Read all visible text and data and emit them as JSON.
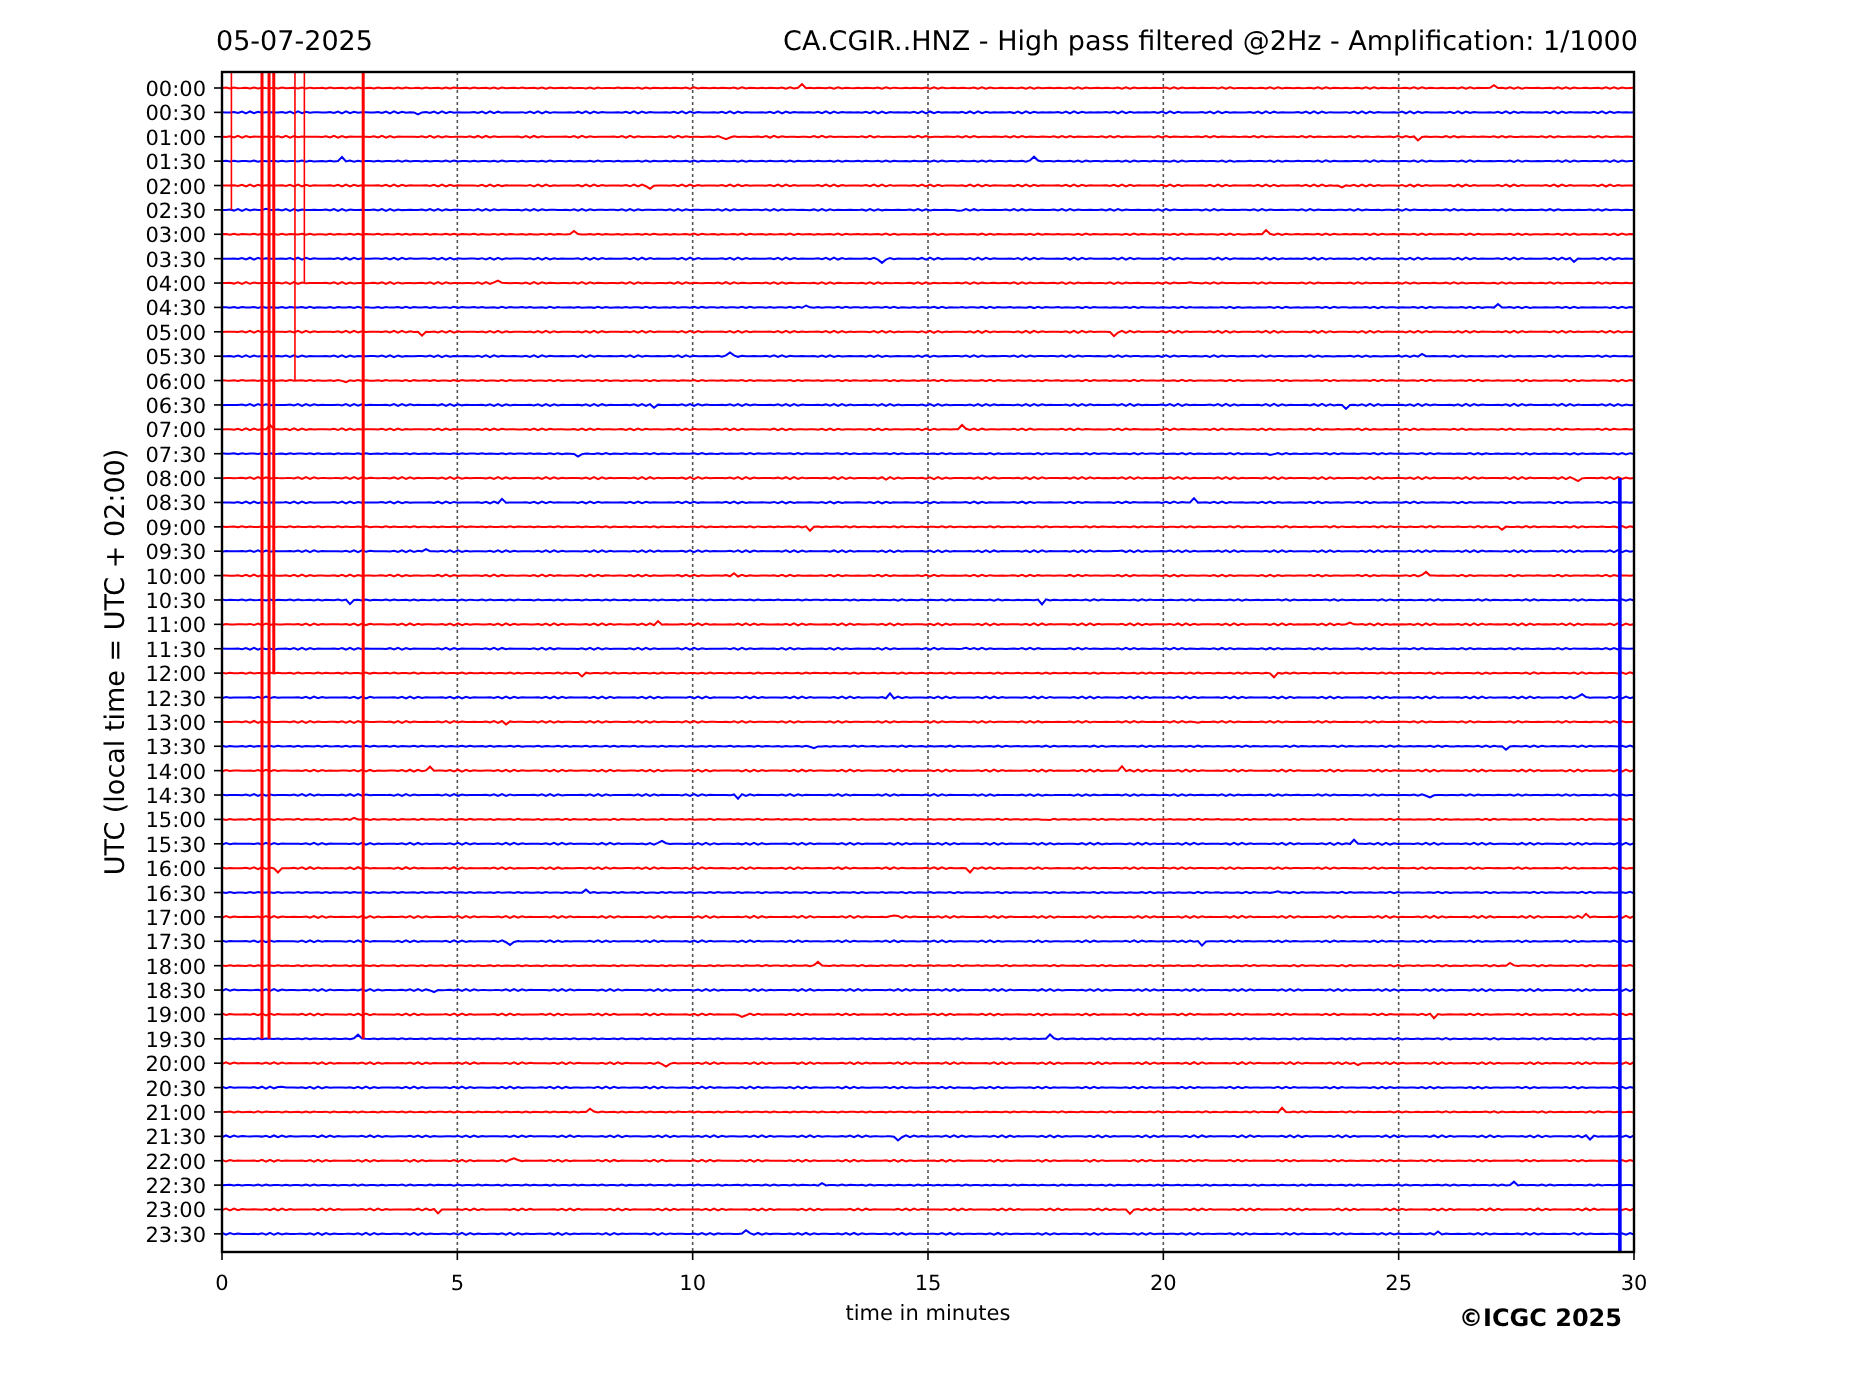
{
  "date": "05-07-2025",
  "title": "CA.CGIR..HNZ - High pass filtered @2Hz - Amplification: 1/1000",
  "y_axis_label": "UTC (local time = UTC + 02:00)",
  "rows": [
    {
      "label": "00:00",
      "color": "#ff0000"
    },
    {
      "label": "00:30",
      "color": "#0000ff"
    },
    {
      "label": "01:00",
      "color": "#ff0000"
    },
    {
      "label": "01:30",
      "color": "#0000ff"
    },
    {
      "label": "02:00",
      "color": "#ff0000"
    },
    {
      "label": "02:30",
      "color": "#0000ff"
    },
    {
      "label": "03:00",
      "color": "#ff0000"
    },
    {
      "label": "03:30",
      "color": "#0000ff"
    },
    {
      "label": "04:00",
      "color": "#ff0000"
    },
    {
      "label": "04:30",
      "color": "#0000ff"
    },
    {
      "label": "05:00",
      "color": "#ff0000"
    },
    {
      "label": "05:30",
      "color": "#0000ff"
    },
    {
      "label": "06:00",
      "color": "#ff0000"
    },
    {
      "label": "06:30",
      "color": "#0000ff"
    },
    {
      "label": "07:00",
      "color": "#ff0000"
    },
    {
      "label": "07:30",
      "color": "#0000ff"
    },
    {
      "label": "08:00",
      "color": "#ff0000"
    },
    {
      "label": "08:30",
      "color": "#0000ff"
    },
    {
      "label": "09:00",
      "color": "#ff0000"
    },
    {
      "label": "09:30",
      "color": "#0000ff"
    },
    {
      "label": "10:00",
      "color": "#ff0000"
    },
    {
      "label": "10:30",
      "color": "#0000ff"
    },
    {
      "label": "11:00",
      "color": "#ff0000"
    },
    {
      "label": "11:30",
      "color": "#0000ff"
    },
    {
      "label": "12:00",
      "color": "#ff0000"
    },
    {
      "label": "12:30",
      "color": "#0000ff"
    },
    {
      "label": "13:00",
      "color": "#ff0000"
    },
    {
      "label": "13:30",
      "color": "#0000ff"
    },
    {
      "label": "14:00",
      "color": "#ff0000"
    },
    {
      "label": "14:30",
      "color": "#0000ff"
    },
    {
      "label": "15:00",
      "color": "#ff0000"
    },
    {
      "label": "15:30",
      "color": "#0000ff"
    },
    {
      "label": "16:00",
      "color": "#ff0000"
    },
    {
      "label": "16:30",
      "color": "#0000ff"
    },
    {
      "label": "17:00",
      "color": "#ff0000"
    },
    {
      "label": "17:30",
      "color": "#0000ff"
    },
    {
      "label": "18:00",
      "color": "#ff0000"
    },
    {
      "label": "18:30",
      "color": "#0000ff"
    },
    {
      "label": "19:00",
      "color": "#ff0000"
    },
    {
      "label": "19:30",
      "color": "#0000ff"
    },
    {
      "label": "20:00",
      "color": "#ff0000"
    },
    {
      "label": "20:30",
      "color": "#0000ff"
    },
    {
      "label": "21:00",
      "color": "#ff0000"
    },
    {
      "label": "21:30",
      "color": "#0000ff"
    },
    {
      "label": "22:00",
      "color": "#ff0000"
    },
    {
      "label": "22:30",
      "color": "#0000ff"
    },
    {
      "label": "23:00",
      "color": "#ff0000"
    },
    {
      "label": "23:30",
      "color": "#0000ff"
    }
  ],
  "x_ticks": [
    "0",
    "5",
    "10",
    "15",
    "20",
    "25",
    "30"
  ],
  "x_axis_label": "time in minutes",
  "copyright": "©ICGC 2025"
}
